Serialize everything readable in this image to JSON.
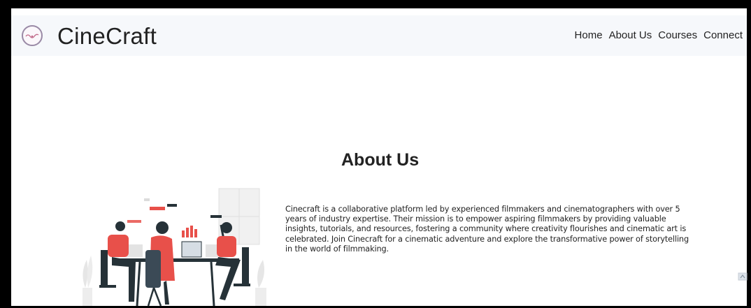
{
  "brand": {
    "name": "CineCraft",
    "logo_icon": "film-reel-icon"
  },
  "nav": {
    "items": [
      {
        "label": "Home"
      },
      {
        "label": "About Us"
      },
      {
        "label": "Courses"
      },
      {
        "label": "Connect"
      }
    ]
  },
  "about": {
    "title": "About Us",
    "description": "Cinecraft is a collaborative platform led by experienced filmmakers and cinematographers with over 5 years of industry expertise. Their mission is to empower aspiring filmmakers by providing valuable insights, tutorials, and resources, fostering a community where creativity flourishes and cinematic art is celebrated. Join Cinecraft for a cinematic adventure and explore the transformative power of storytelling in the world of filmmaking.",
    "illustration_icon": "team-meeting-illustration"
  },
  "colors": {
    "accent": "#e8504a",
    "dark": "#263238",
    "navbar_bg": "#f6f8fb"
  }
}
